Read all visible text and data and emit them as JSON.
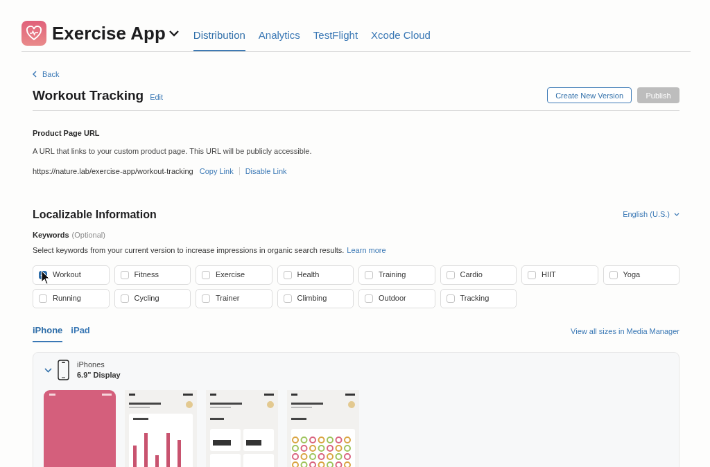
{
  "app": {
    "name": "Exercise App"
  },
  "nav_tabs": [
    {
      "label": "Distribution",
      "selected": true
    },
    {
      "label": "Analytics",
      "selected": false
    },
    {
      "label": "TestFlight",
      "selected": false
    },
    {
      "label": "Xcode Cloud",
      "selected": false
    }
  ],
  "back_link": "Back",
  "page": {
    "title": "Workout Tracking",
    "edit": "Edit",
    "create_button": "Create New Version",
    "publish_button": {
      "label": "Publish",
      "disabled": true
    }
  },
  "product_page_url": {
    "heading": "Product Page URL",
    "description": "A URL that links to your custom product page. This URL will be publicly accessible.",
    "url": "https://nature.lab/exercise-app/workout-tracking",
    "copy_link": "Copy Link",
    "disable_link": "Disable Link"
  },
  "localizable": {
    "heading": "Localizable Information",
    "language": "English (U.S.)",
    "keywords_label": "Keywords",
    "keywords_optional": "(Optional)",
    "keywords_help": "Select keywords from your current version to increase impressions in organic search results.",
    "learn_more": "Learn more"
  },
  "keywords": [
    {
      "label": "Workout",
      "checked": true
    },
    {
      "label": "Fitness",
      "checked": false
    },
    {
      "label": "Exercise",
      "checked": false
    },
    {
      "label": "Health",
      "checked": false
    },
    {
      "label": "Training",
      "checked": false
    },
    {
      "label": "Cardio",
      "checked": false
    },
    {
      "label": "HIIT",
      "checked": false
    },
    {
      "label": "Yoga",
      "checked": false
    },
    {
      "label": "Running",
      "checked": false
    },
    {
      "label": "Cycling",
      "checked": false
    },
    {
      "label": "Trainer",
      "checked": false
    },
    {
      "label": "Climbing",
      "checked": false
    },
    {
      "label": "Outdoor",
      "checked": false
    },
    {
      "label": "Tracking",
      "checked": false
    }
  ],
  "device_tabs": [
    {
      "label": "iPhone",
      "selected": true
    },
    {
      "label": "iPad",
      "selected": false
    }
  ],
  "media_manager_link": "View all sizes in Media Manager",
  "device_group": {
    "expanded": true,
    "name": "iPhones",
    "display": "6.9\" Display"
  },
  "screenshots": [
    {
      "kind": "splash"
    },
    {
      "kind": "activity"
    },
    {
      "kind": "metrics"
    },
    {
      "kind": "calendar"
    }
  ]
}
